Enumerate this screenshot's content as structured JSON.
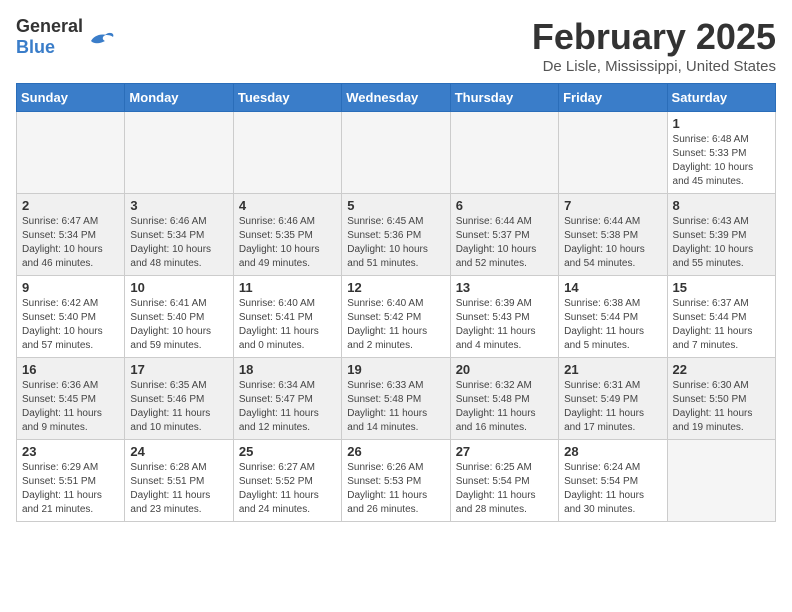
{
  "logo": {
    "general": "General",
    "blue": "Blue"
  },
  "title": "February 2025",
  "location": "De Lisle, Mississippi, United States",
  "weekdays": [
    "Sunday",
    "Monday",
    "Tuesday",
    "Wednesday",
    "Thursday",
    "Friday",
    "Saturday"
  ],
  "weeks": [
    [
      {
        "day": "",
        "info": ""
      },
      {
        "day": "",
        "info": ""
      },
      {
        "day": "",
        "info": ""
      },
      {
        "day": "",
        "info": ""
      },
      {
        "day": "",
        "info": ""
      },
      {
        "day": "",
        "info": ""
      },
      {
        "day": "1",
        "info": "Sunrise: 6:48 AM\nSunset: 5:33 PM\nDaylight: 10 hours and 45 minutes."
      }
    ],
    [
      {
        "day": "2",
        "info": "Sunrise: 6:47 AM\nSunset: 5:34 PM\nDaylight: 10 hours and 46 minutes."
      },
      {
        "day": "3",
        "info": "Sunrise: 6:46 AM\nSunset: 5:34 PM\nDaylight: 10 hours and 48 minutes."
      },
      {
        "day": "4",
        "info": "Sunrise: 6:46 AM\nSunset: 5:35 PM\nDaylight: 10 hours and 49 minutes."
      },
      {
        "day": "5",
        "info": "Sunrise: 6:45 AM\nSunset: 5:36 PM\nDaylight: 10 hours and 51 minutes."
      },
      {
        "day": "6",
        "info": "Sunrise: 6:44 AM\nSunset: 5:37 PM\nDaylight: 10 hours and 52 minutes."
      },
      {
        "day": "7",
        "info": "Sunrise: 6:44 AM\nSunset: 5:38 PM\nDaylight: 10 hours and 54 minutes."
      },
      {
        "day": "8",
        "info": "Sunrise: 6:43 AM\nSunset: 5:39 PM\nDaylight: 10 hours and 55 minutes."
      }
    ],
    [
      {
        "day": "9",
        "info": "Sunrise: 6:42 AM\nSunset: 5:40 PM\nDaylight: 10 hours and 57 minutes."
      },
      {
        "day": "10",
        "info": "Sunrise: 6:41 AM\nSunset: 5:40 PM\nDaylight: 10 hours and 59 minutes."
      },
      {
        "day": "11",
        "info": "Sunrise: 6:40 AM\nSunset: 5:41 PM\nDaylight: 11 hours and 0 minutes."
      },
      {
        "day": "12",
        "info": "Sunrise: 6:40 AM\nSunset: 5:42 PM\nDaylight: 11 hours and 2 minutes."
      },
      {
        "day": "13",
        "info": "Sunrise: 6:39 AM\nSunset: 5:43 PM\nDaylight: 11 hours and 4 minutes."
      },
      {
        "day": "14",
        "info": "Sunrise: 6:38 AM\nSunset: 5:44 PM\nDaylight: 11 hours and 5 minutes."
      },
      {
        "day": "15",
        "info": "Sunrise: 6:37 AM\nSunset: 5:44 PM\nDaylight: 11 hours and 7 minutes."
      }
    ],
    [
      {
        "day": "16",
        "info": "Sunrise: 6:36 AM\nSunset: 5:45 PM\nDaylight: 11 hours and 9 minutes."
      },
      {
        "day": "17",
        "info": "Sunrise: 6:35 AM\nSunset: 5:46 PM\nDaylight: 11 hours and 10 minutes."
      },
      {
        "day": "18",
        "info": "Sunrise: 6:34 AM\nSunset: 5:47 PM\nDaylight: 11 hours and 12 minutes."
      },
      {
        "day": "19",
        "info": "Sunrise: 6:33 AM\nSunset: 5:48 PM\nDaylight: 11 hours and 14 minutes."
      },
      {
        "day": "20",
        "info": "Sunrise: 6:32 AM\nSunset: 5:48 PM\nDaylight: 11 hours and 16 minutes."
      },
      {
        "day": "21",
        "info": "Sunrise: 6:31 AM\nSunset: 5:49 PM\nDaylight: 11 hours and 17 minutes."
      },
      {
        "day": "22",
        "info": "Sunrise: 6:30 AM\nSunset: 5:50 PM\nDaylight: 11 hours and 19 minutes."
      }
    ],
    [
      {
        "day": "23",
        "info": "Sunrise: 6:29 AM\nSunset: 5:51 PM\nDaylight: 11 hours and 21 minutes."
      },
      {
        "day": "24",
        "info": "Sunrise: 6:28 AM\nSunset: 5:51 PM\nDaylight: 11 hours and 23 minutes."
      },
      {
        "day": "25",
        "info": "Sunrise: 6:27 AM\nSunset: 5:52 PM\nDaylight: 11 hours and 24 minutes."
      },
      {
        "day": "26",
        "info": "Sunrise: 6:26 AM\nSunset: 5:53 PM\nDaylight: 11 hours and 26 minutes."
      },
      {
        "day": "27",
        "info": "Sunrise: 6:25 AM\nSunset: 5:54 PM\nDaylight: 11 hours and 28 minutes."
      },
      {
        "day": "28",
        "info": "Sunrise: 6:24 AM\nSunset: 5:54 PM\nDaylight: 11 hours and 30 minutes."
      },
      {
        "day": "",
        "info": ""
      }
    ]
  ]
}
